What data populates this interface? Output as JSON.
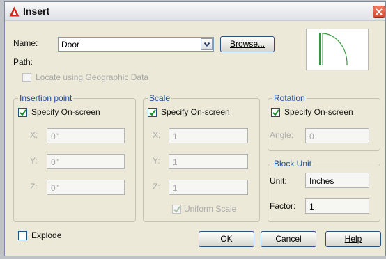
{
  "window": {
    "title": "Insert"
  },
  "name": {
    "label": "Name:",
    "value": "Door",
    "browse_label": "Browse..."
  },
  "path": {
    "label": "Path:"
  },
  "geo": {
    "label": "Locate using Geographic Data",
    "checked": false,
    "enabled": false
  },
  "insertion_point": {
    "title": "Insertion point",
    "specify_label": "Specify On-screen",
    "specify_checked": true,
    "x_label": "X:",
    "x_value": "0\"",
    "y_label": "Y:",
    "y_value": "0\"",
    "z_label": "Z:",
    "z_value": "0\""
  },
  "scale": {
    "title": "Scale",
    "specify_label": "Specify On-screen",
    "specify_checked": true,
    "x_label": "X:",
    "x_value": "1",
    "y_label": "Y:",
    "y_value": "1",
    "z_label": "Z:",
    "z_value": "1",
    "uniform_label": "Uniform Scale",
    "uniform_checked": true
  },
  "rotation": {
    "title": "Rotation",
    "specify_label": "Specify On-screen",
    "specify_checked": true,
    "angle_label": "Angle:",
    "angle_value": "0"
  },
  "block_unit": {
    "title": "Block Unit",
    "unit_label": "Unit:",
    "unit_value": "Inches",
    "factor_label": "Factor:",
    "factor_value": "1"
  },
  "explode": {
    "label": "Explode",
    "checked": false
  },
  "buttons": {
    "ok": "OK",
    "cancel": "Cancel",
    "help": "Help"
  },
  "icons": {
    "app": "autocad-logo-icon",
    "close": "close-icon",
    "dropdown": "chevron-down-icon",
    "check": "check-icon"
  },
  "colors": {
    "group_title": "#1f4c9c",
    "title_logo": "#d2261b",
    "close": "#d14a2e",
    "preview_door": "#2f9a3a"
  }
}
